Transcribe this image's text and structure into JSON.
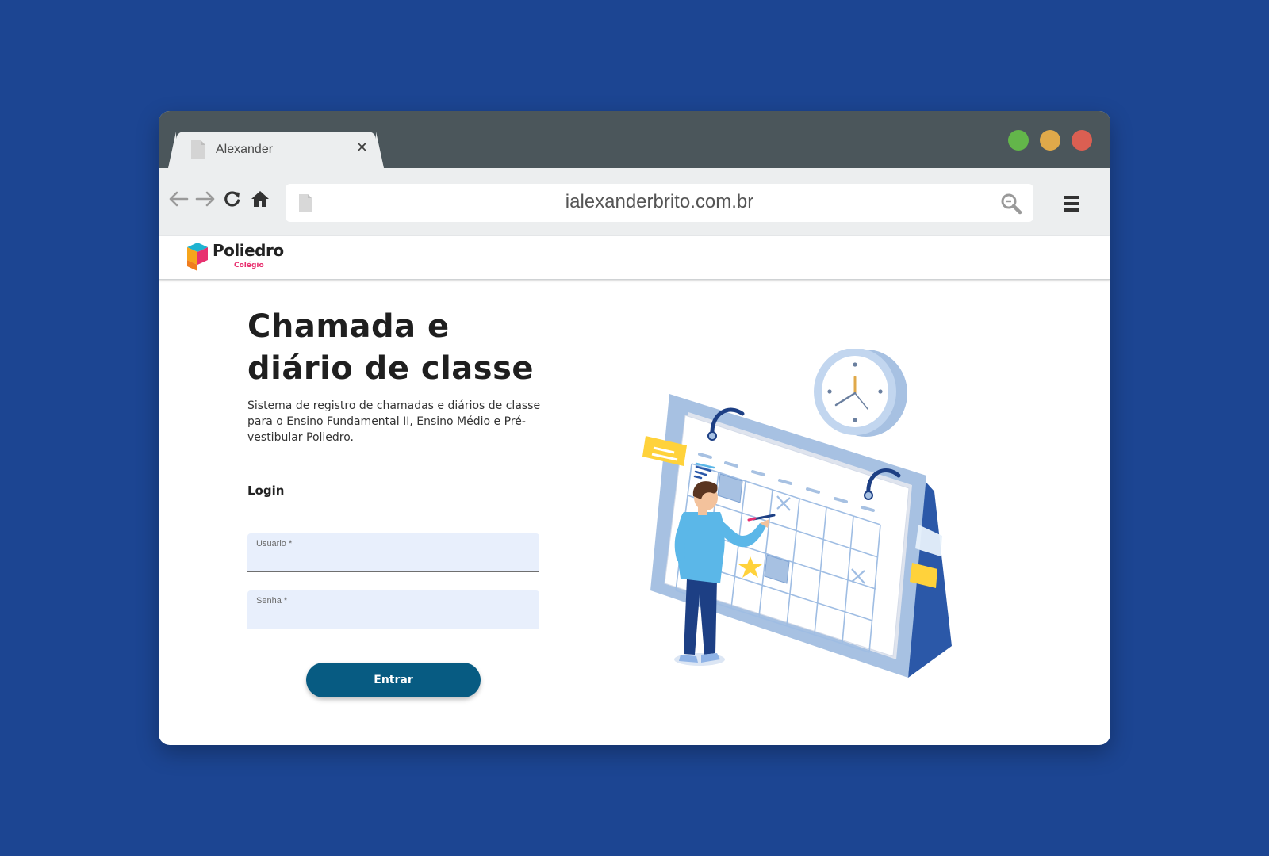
{
  "browser": {
    "tab_title": "Alexander",
    "tab_close": "✕",
    "url": "ialexanderbrito.com.br",
    "window_controls": {
      "green": "#63b64a",
      "yellow": "#e0a94a",
      "red": "#db5f52"
    }
  },
  "site": {
    "logo_name": "Poliedro",
    "logo_sub": "Colégio"
  },
  "main": {
    "title_line1": "Chamada e",
    "title_line2": "diário de classe",
    "description": "Sistema de registro de chamadas e diários de classe para o Ensino Fundamental II, Ensino Médio e Pré-vestibular Poliedro.",
    "login_heading": "Login",
    "username_label": "Usuario *",
    "password_label": "Senha *",
    "submit_label": "Entrar"
  },
  "colors": {
    "page_background": "#1c4592",
    "browser_chrome": "#4b565b",
    "button": "#075b82",
    "input_fill": "#e8effc",
    "brand_accent": "#e8306f"
  },
  "icons": [
    "document-icon",
    "close-icon",
    "back-arrow-icon",
    "forward-arrow-icon",
    "reload-icon",
    "home-icon",
    "search-icon",
    "hamburger-menu-icon"
  ]
}
